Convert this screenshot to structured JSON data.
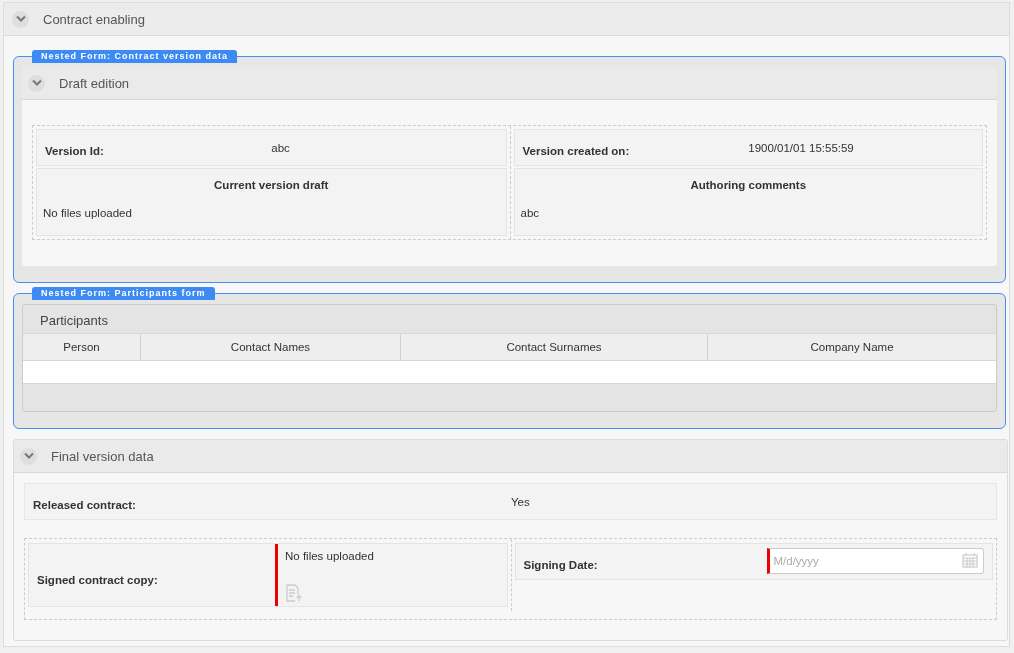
{
  "section": {
    "title": "Contract enabling",
    "expanded": true
  },
  "nested_forms": [
    {
      "kind": "panel",
      "tag": "Nested Form: Contract version data",
      "title": "Draft edition",
      "expanded": true,
      "columns": [
        {
          "label": "Version Id:",
          "value": "abc",
          "heading": "Current version draft",
          "content": "No files uploaded"
        },
        {
          "label": "Version created on:",
          "value": "1900/01/01 15:55:59",
          "heading": "Authoring comments",
          "content": "abc"
        }
      ]
    },
    {
      "kind": "table",
      "tag": "Nested Form: Participants form",
      "title": "Participants",
      "columns": [
        "Person",
        "Contact Names",
        "Contact Surnames",
        "Company Name"
      ]
    }
  ],
  "final_section": {
    "title": "Final version data",
    "expanded": true,
    "released": {
      "label": "Released contract:",
      "value": "Yes"
    },
    "signed_copy": {
      "label": "Signed contract copy:",
      "value": "No files uploaded",
      "required": true
    },
    "signing_date": {
      "label": "Signing Date:",
      "placeholder": "M/d/yyyy",
      "required": true
    }
  }
}
